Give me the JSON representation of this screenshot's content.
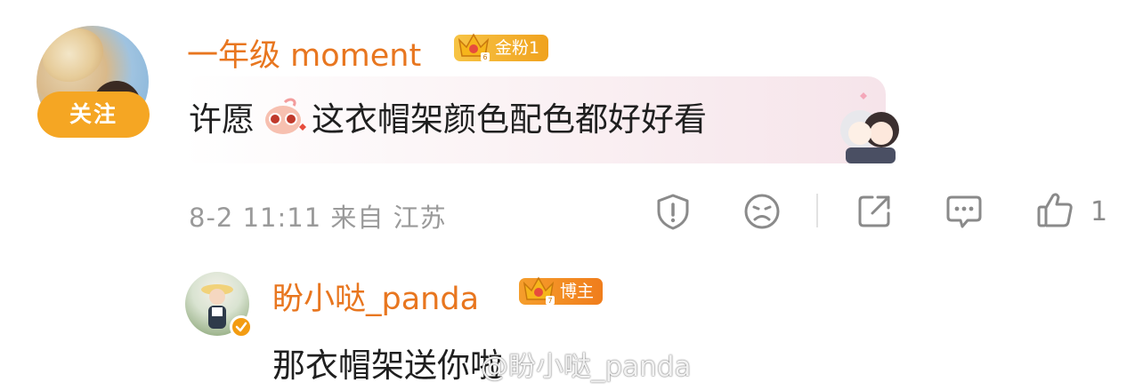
{
  "comment": {
    "username": "一年级 moment",
    "badge_label": "金粉1",
    "badge_level": "6",
    "follow_label": "关注",
    "text_before_sticker": "许愿",
    "text_after_sticker": "这衣帽架颜色配色都好好看",
    "timestamp": "8-2 11:11",
    "location": "来自 江苏",
    "like_count": "1",
    "icons": [
      "report-icon",
      "dislike-icon",
      "share-icon",
      "reply-icon",
      "like-icon"
    ]
  },
  "reply": {
    "username": "盼小哒_panda",
    "badge_label": "博主",
    "badge_level": "7",
    "text": "那衣帽架送你啦"
  },
  "watermark": "@盼小哒_panda",
  "colors": {
    "username": "#e8761f",
    "follow_button": "#f5a623",
    "meta_text": "#9a9a9a"
  }
}
